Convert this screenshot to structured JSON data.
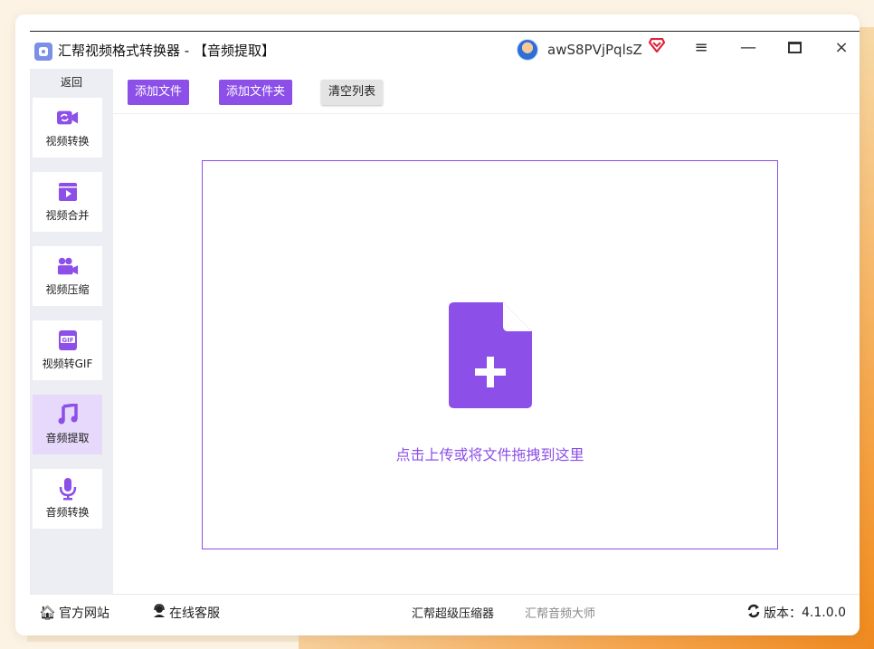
{
  "app": {
    "title": "汇帮视频格式转换器  - 【音频提取】",
    "user_name": "awS8PVjPqlsZ"
  },
  "window_controls": {
    "menu_icon": "hamburger-icon",
    "minimize_icon": "minimize-icon",
    "maximize_icon": "maximize-icon",
    "close_glyph": "×"
  },
  "sidebar": {
    "back_label": "返回",
    "items": [
      {
        "label": "视频转换",
        "icon": "video-convert-icon",
        "active": false
      },
      {
        "label": "视频合并",
        "icon": "video-merge-icon",
        "active": false
      },
      {
        "label": "视频压缩",
        "icon": "video-compress-icon",
        "active": false
      },
      {
        "label": "视频转GIF",
        "icon": "gif-icon",
        "active": false
      },
      {
        "label": "音频提取",
        "icon": "music-note-icon",
        "active": true
      },
      {
        "label": "音频转换",
        "icon": "microphone-icon",
        "active": false
      }
    ]
  },
  "toolbar": {
    "add_file": "添加文件",
    "add_folder": "添加文件夹",
    "clear_list": "清空列表"
  },
  "dropzone": {
    "text": "点击上传或将文件拖拽到这里",
    "icon": "add-file-icon"
  },
  "statusbar": {
    "website": "官方网站",
    "support": "在线客服",
    "product1": "汇帮超级压缩器",
    "product2": "汇帮音频大师",
    "version_label": "版本：",
    "version": "4.1.0.0"
  },
  "colors": {
    "accent": "#8c4fe8",
    "active_bg": "#e7d9fb",
    "sidebar_bg": "#eceef3",
    "vip": "#e0223a"
  }
}
